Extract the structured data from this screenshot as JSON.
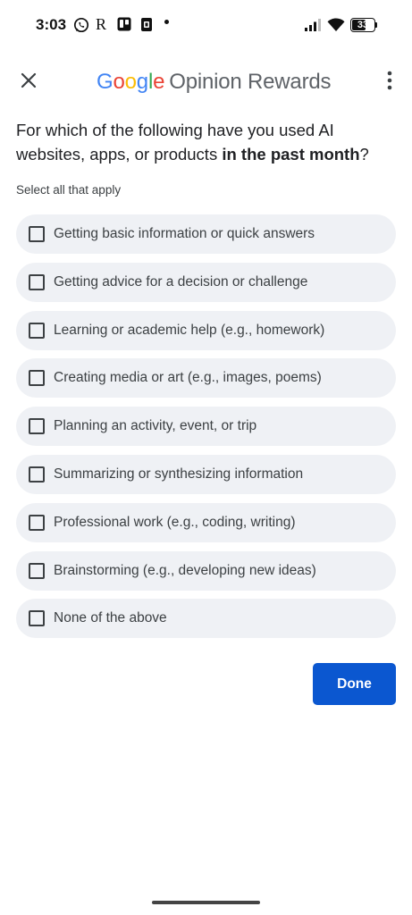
{
  "status_bar": {
    "time": "3:03",
    "notification_letter": "R",
    "battery_level": "33",
    "battery_fraction": 0.33
  },
  "app_bar": {
    "brand": [
      "G",
      "o",
      "o",
      "g",
      "l",
      "e"
    ],
    "brand_colors": [
      "#4285F4",
      "#EA4335",
      "#FBBC05",
      "#4285F4",
      "#34A853",
      "#EA4335"
    ],
    "product": "Opinion Rewards"
  },
  "question": {
    "before": "For which of the following have you used AI websites, apps, or products ",
    "emphasis": "in the past month",
    "after": "?",
    "hint": "Select all that apply"
  },
  "options": [
    {
      "label": "Getting basic information or quick answers",
      "checked": false
    },
    {
      "label": "Getting advice for a decision or challenge",
      "checked": false
    },
    {
      "label": "Learning or academic help (e.g., homework)",
      "checked": false
    },
    {
      "label": "Creating media or art (e.g., images, poems)",
      "checked": false
    },
    {
      "label": "Planning an activity, event, or trip",
      "checked": false
    },
    {
      "label": "Summarizing or synthesizing information",
      "checked": false
    },
    {
      "label": "Professional work (e.g., coding, writing)",
      "checked": false
    },
    {
      "label": "Brainstorming (e.g., developing new ideas)",
      "checked": false
    },
    {
      "label": "None of the above",
      "checked": false
    }
  ],
  "done_label": "Done",
  "colors": {
    "accent": "#0b57d0",
    "option_background": "#eff1f5"
  },
  "icons": {
    "close": "close-icon",
    "more": "more-vert-icon",
    "checkbox": "checkbox-icon"
  }
}
